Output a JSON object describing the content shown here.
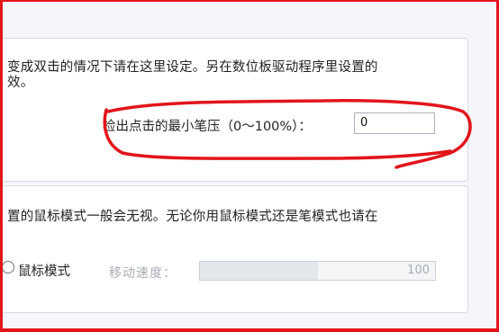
{
  "pen_settings": {
    "description_line1": "变成双击的情况下请在这里设定。另在数位板驱动程序里设置的",
    "description_line2": "效。",
    "min_pressure_label": "检出点击的最小笔压（0～100%）：",
    "min_pressure_value": "0"
  },
  "mode_settings": {
    "description": "置的鼠标模式一般会无视。无论你用鼠标模式还是笔模式也请在",
    "mouse_mode_label": "鼠标模式",
    "move_speed_label": "移动速度：",
    "move_speed_value": "100",
    "move_speed_fraction": 0.5
  },
  "colors": {
    "annotation_red": "#e2151b"
  }
}
